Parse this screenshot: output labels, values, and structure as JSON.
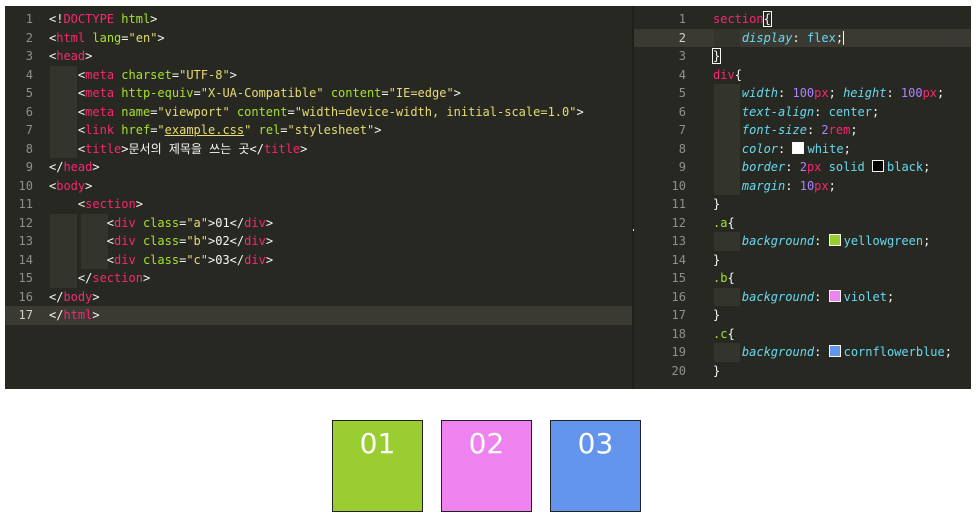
{
  "editor": {
    "left_pane": {
      "line_numbers": [
        "1",
        "2",
        "3",
        "4",
        "5",
        "6",
        "7",
        "8",
        "9",
        "10",
        "11",
        "12",
        "13",
        "14",
        "15",
        "16",
        "17"
      ],
      "html_lines": [
        "<span class=\"p\">&lt;!</span><span class=\"t\">DOCTYPE</span> <span class=\"a\">html</span><span class=\"p\">&gt;</span>",
        "<span class=\"p\">&lt;</span><span class=\"t\">html</span> <span class=\"a\">lang</span><span class=\"p\">=</span><span class=\"s\">\"en\"</span><span class=\"p\">&gt;</span>",
        "<span class=\"p\">&lt;</span><span class=\"t\">head</span><span class=\"p\">&gt;</span>",
        "    <span class=\"p\">&lt;</span><span class=\"t\">meta</span> <span class=\"a\">charset</span><span class=\"p\">=</span><span class=\"s\">\"UTF-8\"</span><span class=\"p\">&gt;</span>",
        "    <span class=\"p\">&lt;</span><span class=\"t\">meta</span> <span class=\"a\">http-equiv</span><span class=\"p\">=</span><span class=\"s\">\"X-UA-Compatible\"</span> <span class=\"a\">content</span><span class=\"p\">=</span><span class=\"s\">\"IE=edge\"</span><span class=\"p\">&gt;</span>",
        "    <span class=\"p\">&lt;</span><span class=\"t\">meta</span> <span class=\"a\">name</span><span class=\"p\">=</span><span class=\"s\">\"viewport\"</span> <span class=\"a\">content</span><span class=\"p\">=</span><span class=\"s\">\"width=device-width, initial-scale=1.0\"</span><span class=\"p\">&gt;</span>",
        "    <span class=\"p\">&lt;</span><span class=\"t\">link</span> <span class=\"a\">href</span><span class=\"p\">=</span><span class=\"s\">\"<span class=\"u\">example.css</span>\"</span> <span class=\"a\">rel</span><span class=\"p\">=</span><span class=\"s\">\"stylesheet\"</span><span class=\"p\">&gt;</span>",
        "    <span class=\"p\">&lt;</span><span class=\"t\">title</span><span class=\"p\">&gt;문서의 제목을 쓰는 곳&lt;/</span><span class=\"t\">title</span><span class=\"p\">&gt;</span>",
        "<span class=\"p\">&lt;/</span><span class=\"t\">head</span><span class=\"p\">&gt;</span>",
        "<span class=\"p\">&lt;</span><span class=\"t\">body</span><span class=\"p\">&gt;</span>",
        "    <span class=\"p\">&lt;</span><span class=\"t\">section</span><span class=\"p\">&gt;</span>",
        "        <span class=\"p\">&lt;</span><span class=\"t\">div</span> <span class=\"a\">class</span><span class=\"p\">=</span><span class=\"s\">\"a\"</span><span class=\"p\">&gt;01&lt;/</span><span class=\"t\">div</span><span class=\"p\">&gt;</span>",
        "        <span class=\"p\">&lt;</span><span class=\"t\">div</span> <span class=\"a\">class</span><span class=\"p\">=</span><span class=\"s\">\"b\"</span><span class=\"p\">&gt;02&lt;/</span><span class=\"t\">div</span><span class=\"p\">&gt;</span>",
        "        <span class=\"p\">&lt;</span><span class=\"t\">div</span> <span class=\"a\">class</span><span class=\"p\">=</span><span class=\"s\">\"c\"</span><span class=\"p\">&gt;03&lt;/</span><span class=\"t\">div</span><span class=\"p\">&gt;</span>",
        "    <span class=\"p\">&lt;/</span><span class=\"t\">section</span><span class=\"p\">&gt;</span>",
        "<span class=\"p\">&lt;/</span><span class=\"t\">body</span><span class=\"p\">&gt;</span>",
        "<span class=\"p\">&lt;/</span><span class=\"t\">html</span><span class=\"p\">&gt;</span>"
      ],
      "active_line": 17
    },
    "right_pane": {
      "line_numbers": [
        "1",
        "2",
        "3",
        "4",
        "5",
        "6",
        "7",
        "8",
        "9",
        "10",
        "11",
        "12",
        "13",
        "14",
        "15",
        "16",
        "17",
        "18",
        "19",
        "20"
      ],
      "html_lines": [
        "<span class=\"sel\">section</span><span class=\"p bracket\">{</span>",
        "    <span class=\"prop\">display</span><span class=\"p\">: </span><span class=\"v\">flex</span><span class=\"p cursor\">;</span>",
        "<span class=\"p bracket\">}</span>",
        "<span class=\"sel\">div</span><span class=\"p\">{</span>",
        "    <span class=\"prop\">width</span><span class=\"p\">: </span><span class=\"n\">100</span><span class=\"t\">px</span><span class=\"p\">; </span><span class=\"prop\">height</span><span class=\"p\">: </span><span class=\"n\">100</span><span class=\"t\">px</span><span class=\"p\">;</span>",
        "    <span class=\"prop\">text-align</span><span class=\"p\">: </span><span class=\"v\">center</span><span class=\"p\">;</span>",
        "    <span class=\"prop\">font-size</span><span class=\"p\">: </span><span class=\"n\">2</span><span class=\"t\">rem</span><span class=\"p\">;</span>",
        "    <span class=\"prop\">color</span><span class=\"p\">: </span><span class=\"swatch\" style=\"background:#ffffff\"></span><span class=\"v\">white</span><span class=\"p\">;</span>",
        "    <span class=\"prop\">border</span><span class=\"p\">: </span><span class=\"n\">2</span><span class=\"t\">px</span> <span class=\"v\">solid</span> <span class=\"swatch\" style=\"background:#000000\"></span><span class=\"v\">black</span><span class=\"p\">;</span>",
        "    <span class=\"prop\">margin</span><span class=\"p\">: </span><span class=\"n\">10</span><span class=\"t\">px</span><span class=\"p\">;</span>",
        "<span class=\"p\">}</span>",
        "<span class=\"cls\">.a</span><span class=\"p\">{</span>",
        "    <span class=\"prop\">background</span><span class=\"p\">: </span><span class=\"swatch\" style=\"background:#9acd32\"></span><span class=\"v\">yellowgreen</span><span class=\"p\">;</span>",
        "<span class=\"p\">}</span>",
        "<span class=\"cls\">.b</span><span class=\"p\">{</span>",
        "    <span class=\"prop\">background</span><span class=\"p\">: </span><span class=\"swatch\" style=\"background:#ee82ee\"></span><span class=\"v\">violet</span><span class=\"p\">;</span>",
        "<span class=\"p\">}</span>",
        "<span class=\"cls\">.c</span><span class=\"p\">{</span>",
        "    <span class=\"prop\">background</span><span class=\"p\">: </span><span class=\"swatch\" style=\"background:#6495ed\"></span><span class=\"v\">cornflowerblue</span><span class=\"p\">;</span>",
        "<span class=\"p\">}</span>"
      ],
      "active_line": 2
    }
  },
  "preview": {
    "boxes": [
      {
        "label": "01",
        "color": "#9acd32"
      },
      {
        "label": "02",
        "color": "#ee82ee"
      },
      {
        "label": "03",
        "color": "#6495ed"
      }
    ]
  }
}
